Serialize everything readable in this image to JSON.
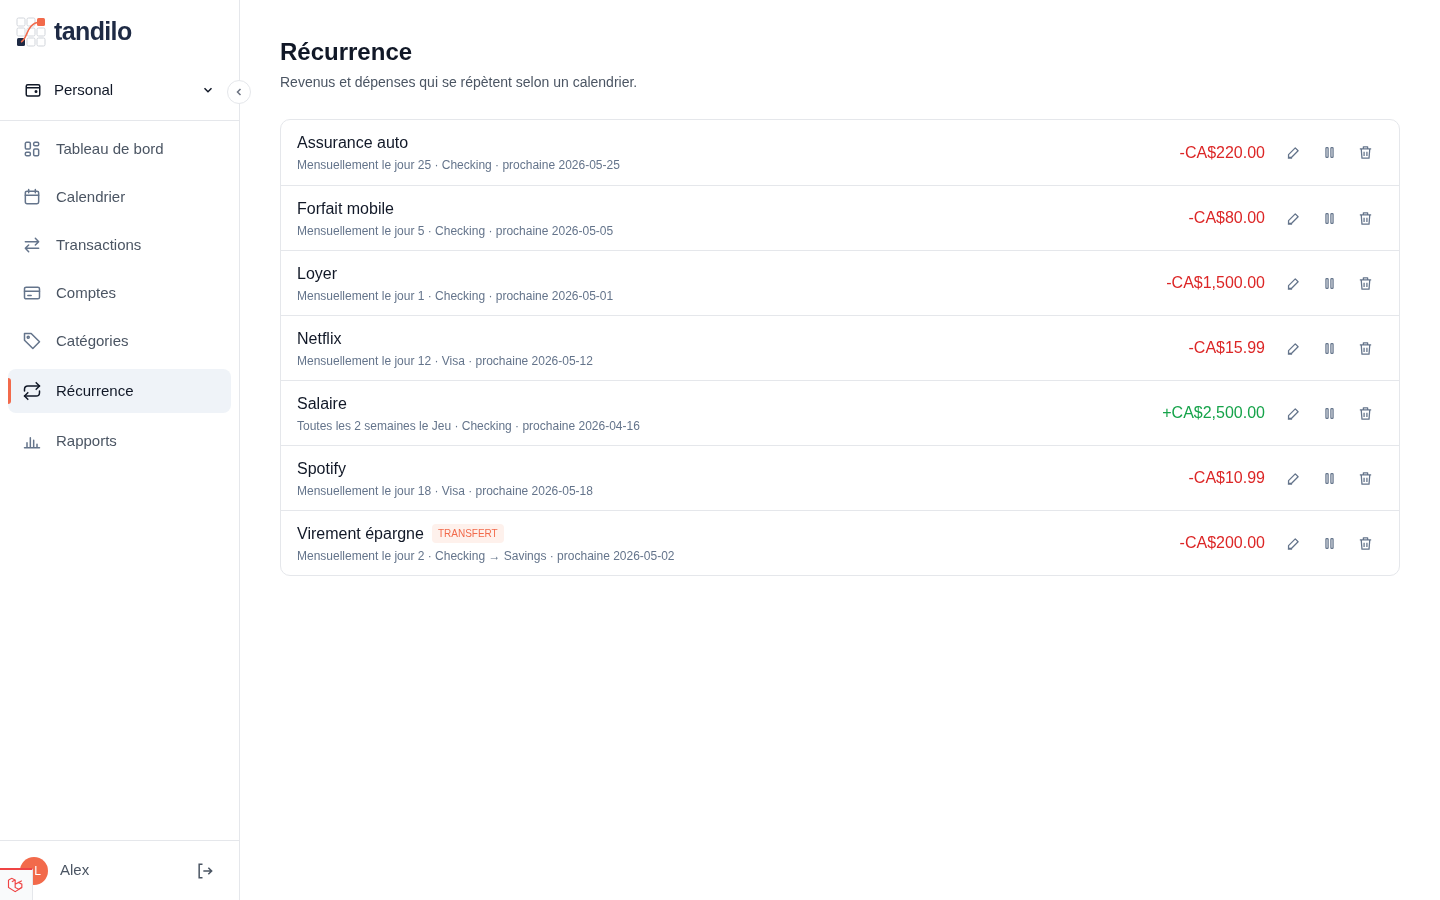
{
  "brand": "tandilo",
  "workspace": {
    "label": "Personal"
  },
  "nav": [
    {
      "label": "Tableau de bord",
      "selected": false
    },
    {
      "label": "Calendrier",
      "selected": false
    },
    {
      "label": "Transactions",
      "selected": false
    },
    {
      "label": "Comptes",
      "selected": false
    },
    {
      "label": "Catégories",
      "selected": false
    },
    {
      "label": "Récurrence",
      "selected": true
    },
    {
      "label": "Rapports",
      "selected": false
    }
  ],
  "user": {
    "initials": "L",
    "name": "Alex"
  },
  "page": {
    "title": "Récurrence",
    "subtitle": "Revenus et dépenses qui se répètent selon un calendrier."
  },
  "rows": [
    {
      "name": "Assurance auto",
      "details": "Mensuellement le jour 25 · Checking · prochaine 2026-05-25",
      "amount": "-CA$220.00",
      "kind": "expense"
    },
    {
      "name": "Forfait mobile",
      "details": "Mensuellement le jour 5 · Checking · prochaine 2026-05-05",
      "amount": "-CA$80.00",
      "kind": "expense"
    },
    {
      "name": "Loyer",
      "details": "Mensuellement le jour 1 · Checking · prochaine 2026-05-01",
      "amount": "-CA$1,500.00",
      "kind": "expense"
    },
    {
      "name": "Netflix",
      "details": "Mensuellement le jour 12 · Visa · prochaine 2026-05-12",
      "amount": "-CA$15.99",
      "kind": "expense"
    },
    {
      "name": "Salaire",
      "details": "Toutes les 2 semaines le Jeu · Checking · prochaine 2026-04-16",
      "amount": "+CA$2,500.00",
      "kind": "income"
    },
    {
      "name": "Spotify",
      "details": "Mensuellement le jour 18 · Visa · prochaine 2026-05-18",
      "amount": "-CA$10.99",
      "kind": "expense"
    },
    {
      "name": "Virement épargne",
      "badge": "TRANSFERT",
      "details": "Mensuellement le jour 2 · Checking → Savings · prochaine 2026-05-02",
      "amount": "-CA$200.00",
      "kind": "expense"
    }
  ]
}
